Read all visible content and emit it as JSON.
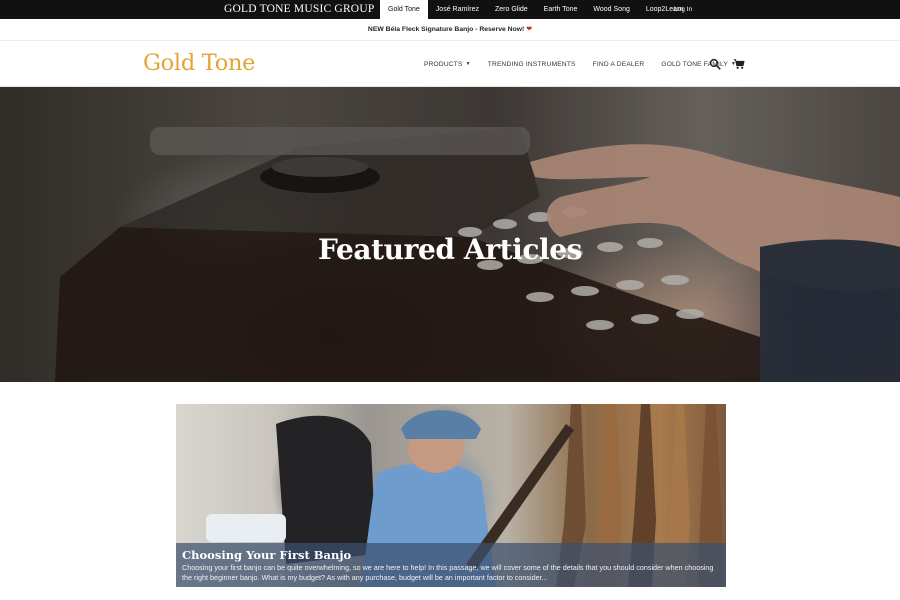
{
  "topbar": {
    "group_name": "GOLD TONE MUSIC GROUP",
    "brands": [
      {
        "label": "Gold Tone",
        "active": true
      },
      {
        "label": "José Ramírez",
        "active": false
      },
      {
        "label": "Zero Glide",
        "active": false
      },
      {
        "label": "Earth Tone",
        "active": false
      },
      {
        "label": "Wood Song",
        "active": false
      },
      {
        "label": "Loop2Learn",
        "active": false
      }
    ],
    "login_label": "Log In"
  },
  "announcement": {
    "text": "NEW Béla Fleck Signature Banjo - Reserve Now!",
    "icon": "heart-icon"
  },
  "nav": {
    "logo": "Gold Tone",
    "links": [
      {
        "label": "PRODUCTS",
        "dropdown": true
      },
      {
        "label": "TRENDING INSTRUMENTS",
        "dropdown": false
      },
      {
        "label": "FIND A DEALER",
        "dropdown": false
      },
      {
        "label": "GOLD TONE FAMILY",
        "dropdown": true
      }
    ],
    "icons": [
      "search-icon",
      "cart-icon"
    ]
  },
  "hero": {
    "title": "Featured Articles"
  },
  "articles": [
    {
      "title": "Choosing Your First Banjo",
      "excerpt": "Choosing your first banjo can be quite overwhelming, so we are here to help! In this passage, we will cover some of the details that you should consider when choosing the right beginner banjo. What is my budget? As with any purchase, budget will be an important factor to consider..."
    }
  ],
  "colors": {
    "brand_gold": "#e3a436",
    "topbar_bg": "#111111",
    "heart_red": "#c62828"
  }
}
